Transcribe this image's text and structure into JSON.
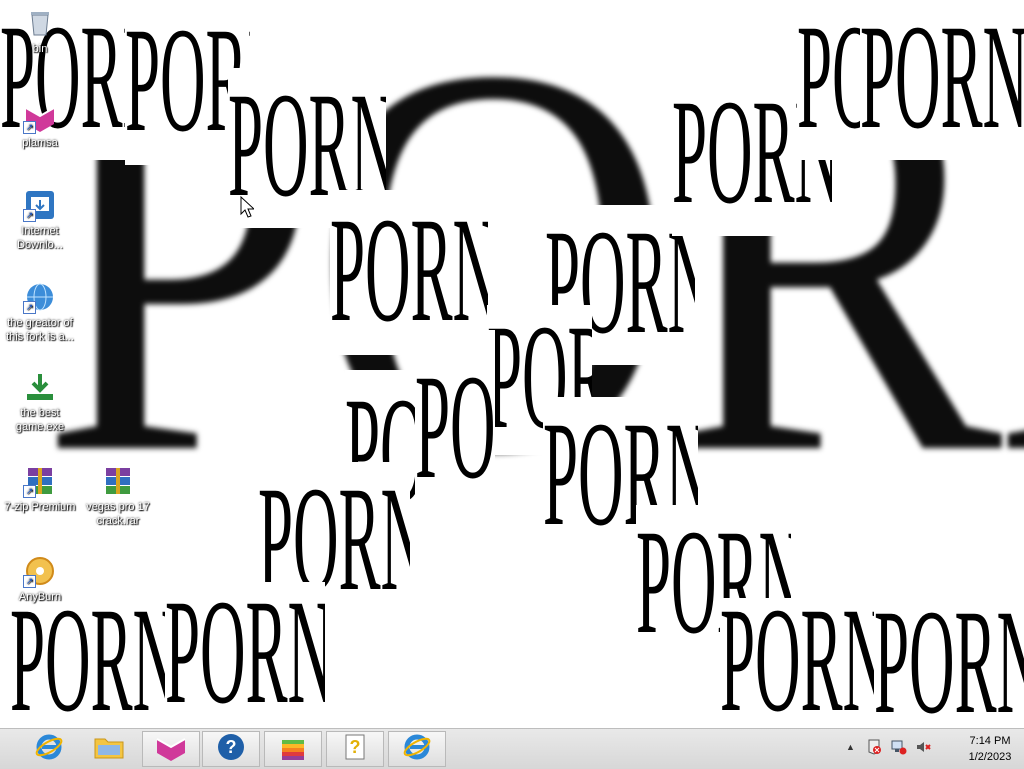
{
  "background_word": "PORN",
  "popups": [
    {
      "text": "PORN",
      "fs": 150,
      "sx": 0.42
    },
    {
      "text": "PORN",
      "fs": 150,
      "sx": 0.42
    },
    {
      "text": "PORN",
      "fs": 150,
      "sx": 0.42
    },
    {
      "text": "PORN",
      "fs": 150,
      "sx": 0.42
    },
    {
      "text": "PORN",
      "fs": 150,
      "sx": 0.42
    },
    {
      "text": "PORN",
      "fs": 150,
      "sx": 0.42
    },
    {
      "text": "PORN",
      "fs": 150,
      "sx": 0.42
    },
    {
      "text": "PORN",
      "fs": 150,
      "sx": 0.42
    },
    {
      "text": "PORN",
      "fs": 150,
      "sx": 0.42
    },
    {
      "text": "PORN",
      "fs": 150,
      "sx": 0.42
    },
    {
      "text": "PORN",
      "fs": 150,
      "sx": 0.42
    },
    {
      "text": "PORN",
      "fs": 150,
      "sx": 0.42
    },
    {
      "text": "PORN",
      "fs": 150,
      "sx": 0.42
    },
    {
      "text": "PORN",
      "fs": 150,
      "sx": 0.42
    },
    {
      "text": "PORN",
      "fs": 150,
      "sx": 0.42
    },
    {
      "text": "PORN",
      "fs": 150,
      "sx": 0.42
    },
    {
      "text": "PORN",
      "fs": 150,
      "sx": 0.42
    },
    {
      "text": "PORN",
      "fs": 150,
      "sx": 0.42
    }
  ],
  "desktop_icons": [
    {
      "label": "bin",
      "icon": "recycle-bin-icon"
    },
    {
      "label": "plamsa",
      "icon": "plasma-app-icon"
    },
    {
      "label": "Internet Downlo...",
      "icon": "internet-download-manager-icon"
    },
    {
      "label": "the greator of this fork is a...",
      "icon": "internet-shortcut-icon"
    },
    {
      "label": "the best game.exe",
      "icon": "download-arrow-icon"
    },
    {
      "label": "7-zip Premium",
      "icon": "winrar-archive-icon"
    },
    {
      "label": "vegas pro 17 crack.rar",
      "icon": "winrar-archive-icon"
    },
    {
      "label": "AnyBurn",
      "icon": "anyburn-disc-icon"
    }
  ],
  "taskbar": {
    "buttons": [
      {
        "name": "internet-explorer",
        "icon": "internet-explorer-icon"
      },
      {
        "name": "file-explorer",
        "icon": "folder-icon"
      },
      {
        "name": "plasma",
        "icon": "plasma-app-icon"
      },
      {
        "name": "help",
        "icon": "help-question-icon"
      },
      {
        "name": "apple",
        "icon": "apple-rainbow-icon"
      },
      {
        "name": "help-document",
        "icon": "help-document-icon"
      },
      {
        "name": "internet-explorer-2",
        "icon": "internet-explorer-icon"
      }
    ]
  },
  "tray": {
    "overflow": "▲",
    "time": "7:14 PM",
    "date": "1/2/2023"
  },
  "colors": {
    "taskbar": "#dcdcdc",
    "plasma": "#d0399a",
    "help_blue": "#1f5fa8",
    "ie_blue": "#2b88d8"
  }
}
